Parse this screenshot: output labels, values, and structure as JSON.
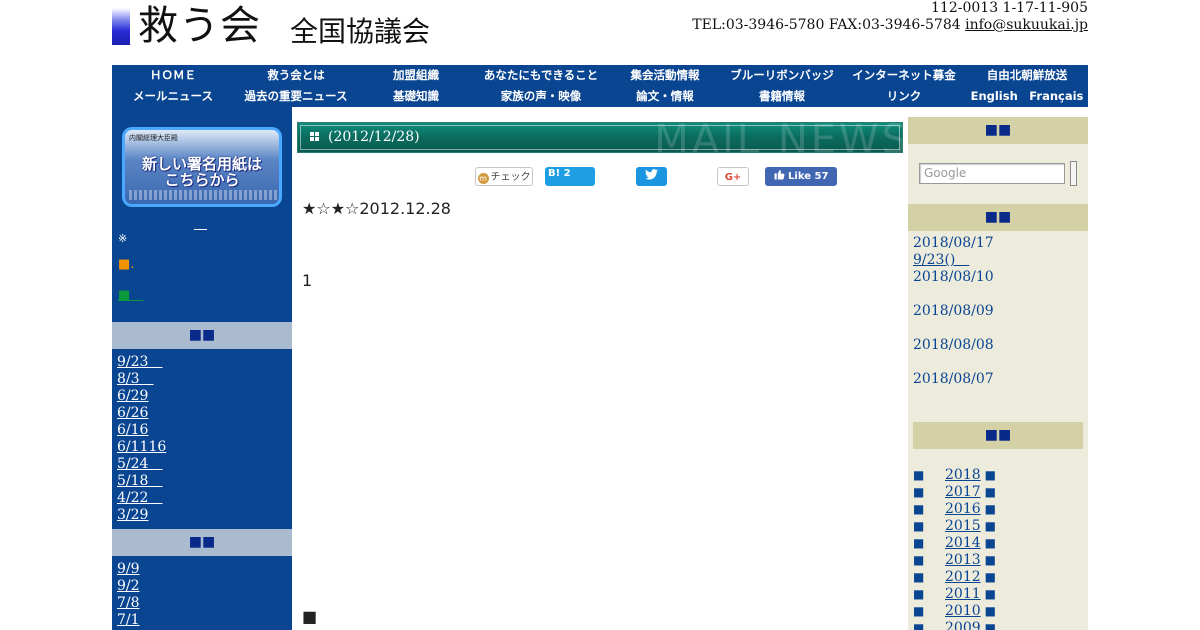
{
  "header": {
    "logo_main": "救う会",
    "logo_sub": "全国協議会",
    "address": "112-0013 1-17-11-905",
    "phone_fax": "TEL:03-3946-5780 FAX:03-3946-5784 ",
    "email": "info@sukuukai.jp"
  },
  "nav": {
    "row1": [
      "ＨＯＭＥ",
      "救う会とは",
      "加盟組織",
      "あなたにもできること",
      "集会活動情報",
      "ブルーリボンバッジ",
      "インターネット募金",
      "自由北朝鮮放送"
    ],
    "row2": [
      "メールニュース",
      "過去の重要ニュース",
      "基礎知識",
      "家族の声・映像",
      "論文・情報",
      "書籍情報",
      "リンク",
      "English　Français"
    ]
  },
  "left": {
    "banner_top": "内閣総理大臣殿",
    "banner_text": "新しい署名用紙は\nこちらから",
    "under_link": "＿",
    "note": "※",
    "square_orange_item": "■.",
    "square_green_item": "■＿",
    "section1_heading": "■■",
    "section1_links": [
      "9/23　",
      "8/3　",
      "6/29",
      "6/26",
      "6/16",
      "6/1116",
      "5/24　",
      "5/18　",
      "4/22　",
      "3/29"
    ],
    "section2_heading": "■■",
    "section2_links": [
      "9/9",
      "9/2",
      "7/8",
      "7/1"
    ]
  },
  "center": {
    "title": "(2012/12/28)",
    "title_watermark": "MAIL NEWS",
    "share": {
      "mixi": "チェック",
      "mixi_icon": "m",
      "hatena": "B! 2",
      "tweet_icon": "twitter-bird-icon",
      "gplus": "G+",
      "fb_like": "Like 57"
    },
    "post_date": "★☆★☆2012.12.28",
    "post_one": "1",
    "post_square": "■"
  },
  "right": {
    "heading1": "■■",
    "search_placeholder": "Google",
    "heading2": "■■",
    "news": [
      "2018/08/17",
      "9/23()　",
      "2018/08/10",
      "",
      "2018/08/09",
      "",
      "2018/08/08",
      "",
      "2018/08/07"
    ],
    "heading3": "■■",
    "years": [
      "2018",
      "2017",
      "2016",
      "2015",
      "2014",
      "2013",
      "2012",
      "2011",
      "2010",
      "2009"
    ],
    "year_bullet": "■"
  },
  "colors": {
    "nav_blue": "#0a4592",
    "title_green": "#0b6b5e",
    "right_bg": "#ecebdc",
    "right_heading": "#d4d1a6",
    "left_heading": "#aabbd0"
  }
}
